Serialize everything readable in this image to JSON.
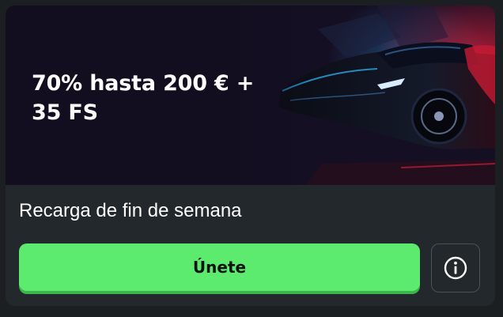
{
  "promo": {
    "headline_line1": "70% hasta 200 € +",
    "headline_line2": "35 FS",
    "subtitle": "Recarga de fin de semana"
  },
  "actions": {
    "join_label": "Únete",
    "info_icon": "info-circle-icon"
  },
  "colors": {
    "card_background": "#22282b",
    "page_background": "#1b1f22",
    "button_green": "#5ceb6e",
    "banner_background": "#130d20",
    "accent_red": "#e0203a",
    "accent_blue": "#2aa7e6"
  }
}
